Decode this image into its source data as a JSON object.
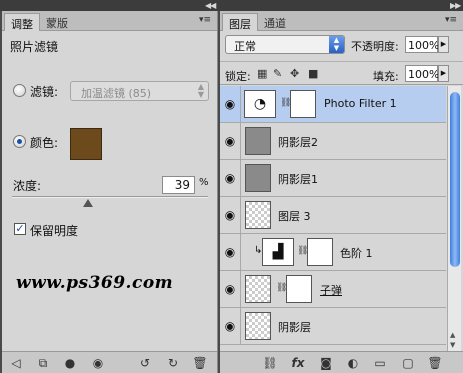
{
  "colors": {
    "photo_filter": "#6d4a1c",
    "selected_layer": "#b6cdef",
    "scroll_thumb": "#3f7fe0"
  },
  "left": {
    "tabs": [
      "调整",
      "蒙版"
    ],
    "title": "照片滤镜",
    "filter_label": "滤镜:",
    "filter_value": "加温滤镜 (85)",
    "color_label": "颜色:",
    "density_label": "浓度:",
    "density_value": "39",
    "percent": "%",
    "density_fraction": 0.39,
    "preserve_label": "保留明度",
    "preserve_checked": true,
    "watermark": "www.ps369.com",
    "bottom_icons": [
      "back-arrow-icon",
      "expand-view-icon",
      "clip-layer-icon",
      "visibility-eye-icon",
      "previous-state-icon",
      "reset-icon",
      "trash-icon"
    ]
  },
  "right": {
    "tabs": [
      "图层",
      "通道"
    ],
    "blend_mode": "正常",
    "opacity_label": "不透明度:",
    "opacity_value": "100%",
    "lock_label": "锁定:",
    "fill_label": "填充:",
    "fill_value": "100%",
    "layers": [
      {
        "name": "Photo Filter 1",
        "type": "adjustment",
        "selected": true
      },
      {
        "name": "阴影层2",
        "type": "gray"
      },
      {
        "name": "阴影层1",
        "type": "gray"
      },
      {
        "name": "图层 3",
        "type": "transparent"
      },
      {
        "name": "色阶 1",
        "type": "adjustment-levels",
        "clipped": true
      },
      {
        "name": "子弹",
        "type": "smart",
        "underline": true
      },
      {
        "name": "阴影层",
        "type": "transparent"
      }
    ],
    "bottom_icons": [
      "link-icon",
      "fx-icon",
      "mask-icon",
      "adjustment-icon",
      "folder-icon",
      "new-layer-icon",
      "trash-icon"
    ]
  }
}
